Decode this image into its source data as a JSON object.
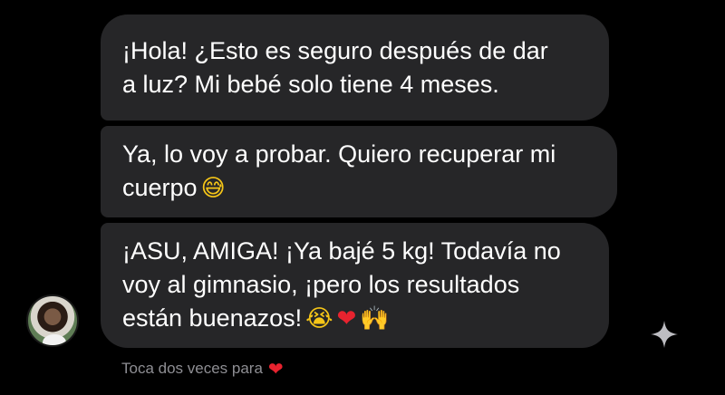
{
  "messages": [
    {
      "lines": [
        "¡Hola! ¿Esto es seguro después de dar",
        "a luz? Mi bebé solo tiene 4 meses."
      ]
    },
    {
      "lines": [
        "Ya, lo voy a probar. Quiero recuperar mi",
        "cuerpo"
      ],
      "emojis": [
        "😅"
      ]
    },
    {
      "lines": [
        "¡ASU, AMIGA! ¡Ya bajé 5 kg! Todavía no",
        "voy al gimnasio, ¡pero los resultados",
        "están buenazos!"
      ],
      "emojis": [
        "😭",
        "❤",
        "🙌"
      ]
    }
  ],
  "hint": {
    "text": "Toca dos veces para",
    "icon": "❤"
  },
  "icons": {
    "sparkle": "sparkle-icon",
    "avatar": "contact-avatar"
  },
  "colors": {
    "background": "#000000",
    "bubble": "#262628",
    "text": "#ffffff",
    "hint": "#8e8e93",
    "heart": "#e8232f"
  }
}
